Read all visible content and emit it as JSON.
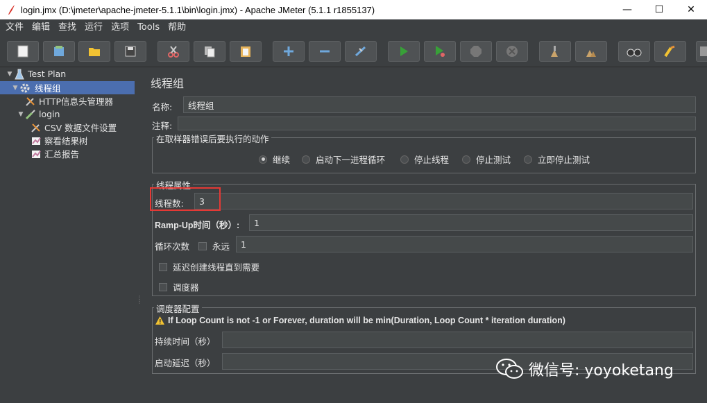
{
  "window": {
    "title": "login.jmx (D:\\jmeter\\apache-jmeter-5.1.1\\bin\\login.jmx) - Apache JMeter (5.1.1 r1855137)",
    "minimize": "—",
    "maximize": "☐",
    "close": "✕"
  },
  "menu": [
    "文件",
    "编辑",
    "查找",
    "运行",
    "选项",
    "Tools",
    "帮助"
  ],
  "toolbar": {
    "buttons": [
      "new-icon",
      "templates-icon",
      "open-icon",
      "save-icon",
      "cut-icon",
      "copy-icon",
      "paste-icon",
      "expand-icon",
      "collapse-icon",
      "toggle-icon",
      "start-icon",
      "start-no-pause-icon",
      "stop-icon",
      "shutdown-icon",
      "clear-icon",
      "clear-all-icon",
      "search-icon",
      "reset-search-icon",
      "function-helper-icon"
    ]
  },
  "tree": {
    "nodes": [
      {
        "label": "Test Plan"
      },
      {
        "label": "线程组"
      },
      {
        "label": "HTTP信息头管理器"
      },
      {
        "label": "login"
      },
      {
        "label": "CSV 数据文件设置"
      },
      {
        "label": "察看结果树"
      },
      {
        "label": "汇总报告"
      }
    ]
  },
  "panel": {
    "title": "线程组",
    "name_label": "名称:",
    "name_value": "线程组",
    "comment_label": "注释:",
    "comment_value": "",
    "error_group_title": "在取样器错误后要执行的动作",
    "error_actions": [
      {
        "label": "继续",
        "selected": true
      },
      {
        "label": "启动下一进程循环",
        "selected": false
      },
      {
        "label": "停止线程",
        "selected": false
      },
      {
        "label": "停止测试",
        "selected": false
      },
      {
        "label": "立即停止测试",
        "selected": false
      }
    ],
    "thread_group_title": "线程属性",
    "threads_label": "线程数:",
    "threads_value": "3",
    "rampup_label": "Ramp-Up时间（秒）:",
    "rampup_value": "1",
    "loop_label": "循环次数",
    "forever_label": "永远",
    "loop_value": "1",
    "delay_label": "延迟创建线程直到需要",
    "scheduler_label": "调度器",
    "scheduler_group_title": "调度器配置",
    "warning_text": "If Loop Count is not -1 or Forever, duration will be min(Duration, Loop Count * iteration duration)",
    "duration_label": "持续时间（秒）",
    "duration_value": "",
    "startup_delay_label": "启动延迟（秒）",
    "startup_delay_value": ""
  },
  "watermark": {
    "text": "微信号: yoyoketang"
  },
  "colors": {
    "background": "#3c3f41",
    "selection": "#4b6eaf",
    "highlight": "#e53935"
  }
}
